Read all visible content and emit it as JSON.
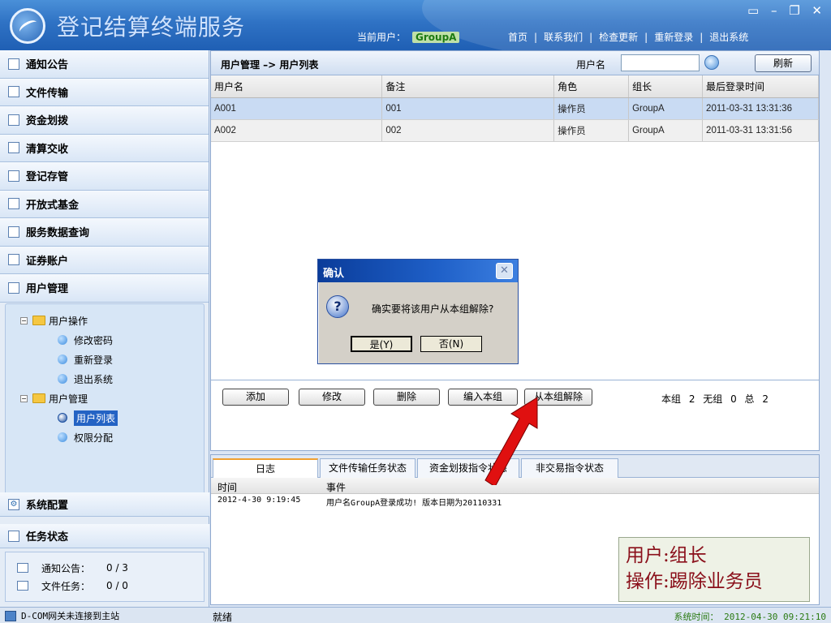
{
  "app": {
    "title": "登记结算终端服务",
    "current_user_label": "当前用户：",
    "current_user": "GroupA",
    "nav_links": [
      "首页",
      "|",
      "联系我们",
      "|",
      "检查更新",
      "|",
      "重新登录",
      "|",
      "退出系统"
    ],
    "window_controls": "▭ – ❐ ✕"
  },
  "sidebar": {
    "items": [
      {
        "label": "通知公告",
        "icon": "notice-icon"
      },
      {
        "label": "文件传输",
        "icon": "file-transfer-icon"
      },
      {
        "label": "资金划拨",
        "icon": "fund-transfer-icon"
      },
      {
        "label": "清算交收",
        "icon": "settlement-icon"
      },
      {
        "label": "登记存管",
        "icon": "registry-icon"
      },
      {
        "label": "开放式基金",
        "icon": "fund-icon"
      },
      {
        "label": "服务数据查询",
        "icon": "query-icon"
      },
      {
        "label": "证券账户",
        "icon": "account-icon"
      },
      {
        "label": "用户管理",
        "icon": "users-icon"
      }
    ],
    "tree": {
      "group1": {
        "label": "用户操作",
        "children": [
          "修改密码",
          "重新登录",
          "退出系统"
        ]
      },
      "group2": {
        "label": "用户管理",
        "children": [
          "用户列表",
          "权限分配"
        ]
      }
    },
    "system_config": "系统配置",
    "task_status": "任务状态",
    "tasks": [
      {
        "label": "通知公告：",
        "value": "0 / 3"
      },
      {
        "label": "文件任务：",
        "value": "0 / 0"
      }
    ]
  },
  "main": {
    "breadcrumb": "用户管理 –> 用户列表",
    "username_label": "用户名",
    "username_value": "",
    "refresh": "刷新",
    "columns": [
      "用户名",
      "备注",
      "角色",
      "组长",
      "最后登录时间"
    ],
    "rows": [
      [
        "A001",
        "001",
        "操作员",
        "GroupA",
        "2011-03-31 13:31:36"
      ],
      [
        "A002",
        "002",
        "操作员",
        "GroupA",
        "2011-03-31 13:31:56"
      ]
    ],
    "buttons": [
      "添加",
      "修改",
      "删除",
      "编入本组",
      "从本组解除"
    ],
    "counts": "本组 2 无组 0 总 2"
  },
  "dialog": {
    "title": "确认",
    "message": "确实要将该用户从本组解除?",
    "yes": "是(Y)",
    "no": "否(N)"
  },
  "log": {
    "tabs": [
      "日志",
      "文件传输任务状态",
      "资金划拨指令状态",
      "非交易指令状态"
    ],
    "col_time": "时间",
    "col_event": "事件",
    "entries": [
      {
        "time": "2012-4-30 9:19:45",
        "event": "用户名GroupA登录成功! 版本日期为20110331"
      }
    ]
  },
  "annotation": {
    "line1": "用户:组长",
    "line2": "操作:踢除业务员"
  },
  "statusbar": {
    "gateway": "D-COM网关未连接到主站",
    "ready": "就绪",
    "clock": "系统时间： 2012-04-30 09:21:10"
  },
  "colors": {
    "title_bar": "#2f72c4",
    "selected_row": "#c9dbf3",
    "annotation_text": "#8a0f1a",
    "arrow": "#e01010"
  }
}
